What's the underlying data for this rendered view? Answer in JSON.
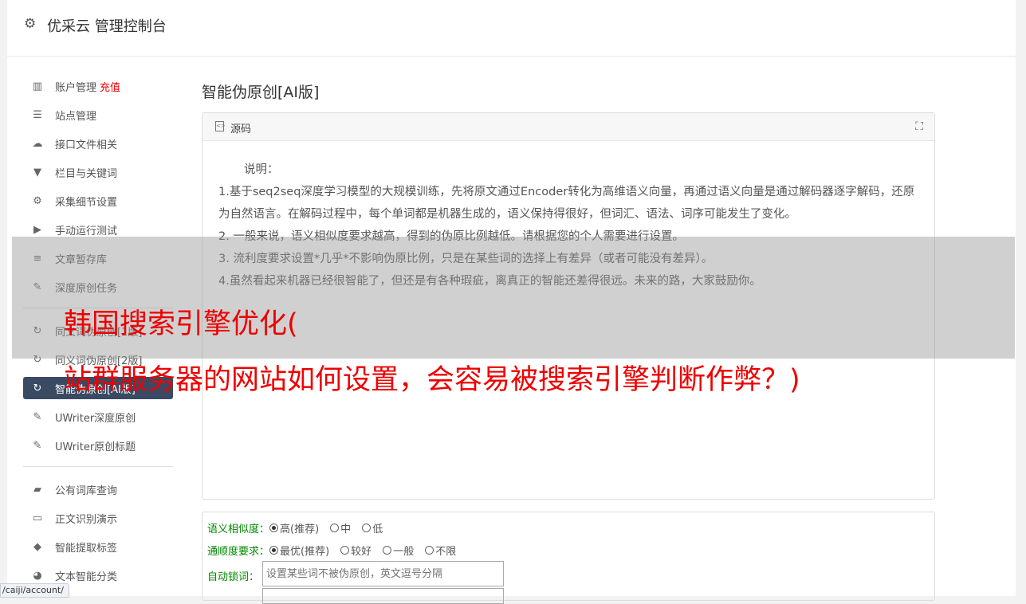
{
  "header": {
    "title": "优采云 管理控制台"
  },
  "sidebar": {
    "group1": [
      {
        "icon": "bar-chart-icon",
        "glyph": "▥",
        "label": "账户管理",
        "extra": "充值"
      },
      {
        "icon": "list-icon",
        "glyph": "☰",
        "label": "站点管理"
      },
      {
        "icon": "cloud-upload-icon",
        "glyph": "☁",
        "label": "接口文件相关"
      },
      {
        "icon": "filter-icon",
        "glyph": "▼",
        "label": "栏目与关键词"
      },
      {
        "icon": "gears-icon",
        "glyph": "⚙",
        "label": "采集细节设置"
      },
      {
        "icon": "play-icon",
        "glyph": "▶",
        "label": "手动运行测试"
      },
      {
        "icon": "database-icon",
        "glyph": "≡",
        "label": "文章暂存库"
      },
      {
        "icon": "edit-icon",
        "glyph": "✎",
        "label": "深度原创任务"
      }
    ],
    "group2": [
      {
        "icon": "refresh-icon",
        "glyph": "↻",
        "label": "同义词伪原创[1版]"
      },
      {
        "icon": "refresh-icon",
        "glyph": "↻",
        "label": "同义词伪原创[2版]"
      },
      {
        "icon": "refresh-icon",
        "glyph": "↻",
        "label": "智能伪原创[AI版]",
        "active": true
      },
      {
        "icon": "edit-icon",
        "glyph": "✎",
        "label": "UWriter深度原创"
      },
      {
        "icon": "edit-icon",
        "glyph": "✎",
        "label": "UWriter原创标题"
      }
    ],
    "group3": [
      {
        "icon": "book-icon",
        "glyph": "▰",
        "label": "公有词库查询"
      },
      {
        "icon": "monitor-icon",
        "glyph": "▭",
        "label": "正文识别演示"
      },
      {
        "icon": "tag-icon",
        "glyph": "◆",
        "label": "智能提取标签"
      },
      {
        "icon": "pie-chart-icon",
        "glyph": "◕",
        "label": "文本智能分类"
      }
    ]
  },
  "main": {
    "title": "智能伪原创[AI版]",
    "panel": {
      "label": "源码",
      "intro": "说明：",
      "lines": [
        "1.基于seq2seq深度学习模型的大规模训练，先将原文通过Encoder转化为高维语义向量，再通过语义向量是通过解码器逐字解码，还原为自然语言。在解码过程中，每个单词都是机器生成的，语义保持得很好，但词汇、语法、词序可能发生了变化。",
        "2. 一般来说，语义相似度要求越高，得到的伪原比例越低。请根据您的个人需要进行设置。",
        "3. 流利度要求设置*几乎*不影响伪原比例，只是在某些词的选择上有差异（或者可能没有差异）。",
        "4.虽然看起来机器已经很智能了，但还是有各种瑕疵，离真正的智能还差得很远。未来的路，大家鼓励你。"
      ]
    },
    "form": {
      "similarity_label": "语义相似度：",
      "similarity_options": [
        "高(推荐)",
        "中",
        "低"
      ],
      "fluency_label": "通顺度要求：",
      "fluency_options": [
        "最优(推荐)",
        "较好",
        "一般",
        "不限"
      ],
      "lock_label": "自动锁词：",
      "lock_placeholder": "设置某些词不被伪原创，英文逗号分隔"
    }
  },
  "overlay": {
    "line1": "韩国搜索引擎优化(",
    "line2": "站群服务器的网站如何设置，会容易被搜索引擎判断作弊？)"
  },
  "statusbar": {
    "url": "/caiji/account/"
  }
}
